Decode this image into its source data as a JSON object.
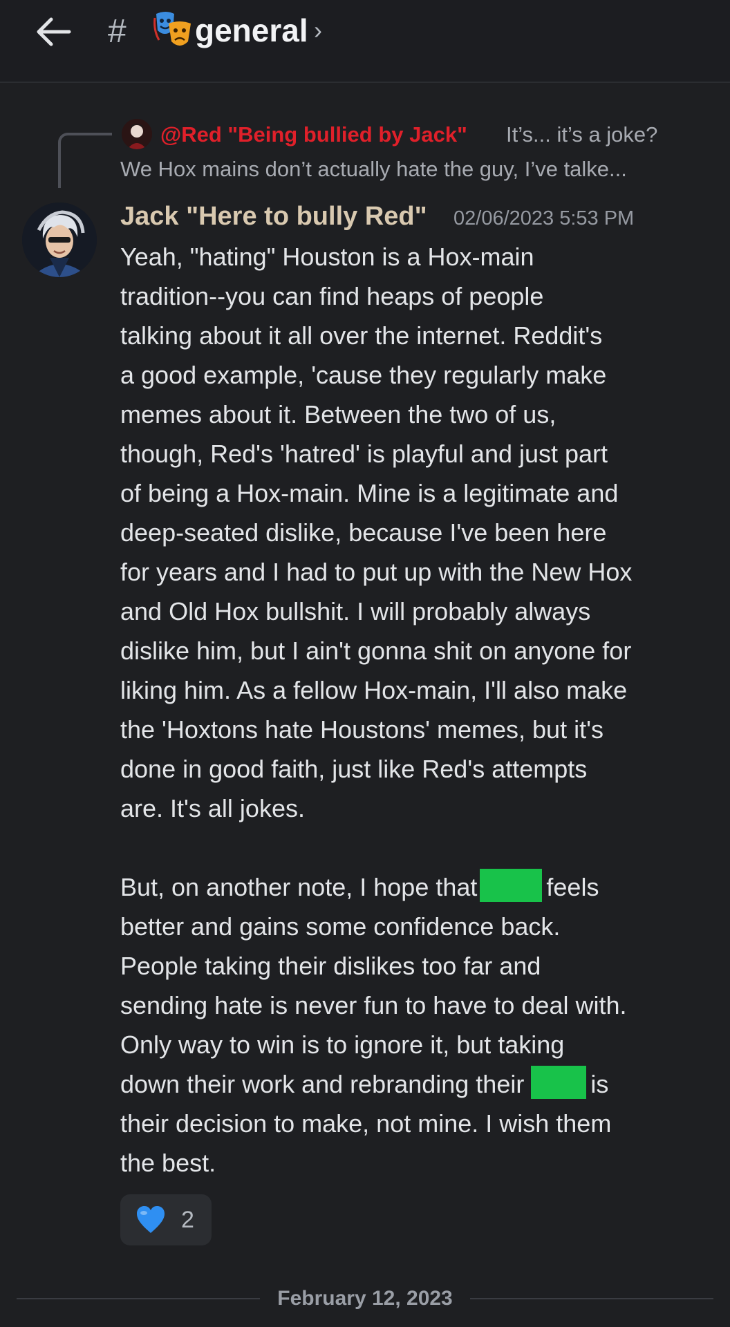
{
  "header": {
    "channel_name": "general",
    "icons": [
      "back-arrow-icon",
      "hash-icon",
      "theater-masks-emoji",
      "chevron-right-icon"
    ]
  },
  "reply": {
    "author": "@Red \"Being bullied by Jack\"",
    "text_line1": "It’s... it’s a joke?",
    "text_line2": "We Hox mains don’t actually hate the guy, I’ve talke...",
    "author_color": "#e0202a"
  },
  "message": {
    "author": "Jack \"Here to bully Red\"",
    "timestamp": "02/06/2023 5:53 PM",
    "lines": [
      "Yeah, \"hating\" Houston is a Hox-main",
      "tradition--you can find heaps of people",
      "talking about it all over the internet. Reddit's",
      "a good example, 'cause they regularly make",
      "memes about it. Between the two of us,",
      "though, Red's 'hatred' is playful and just part",
      "of being a Hox-main. Mine is a legitimate and",
      "deep-seated dislike, because I've been here",
      "for years and I had to put up with the New Hox",
      "and Old Hox bullshit. I will probably always",
      "dislike him, but I ain't gonna shit on anyone for",
      "liking him. As a fellow Hox-main, I'll also make",
      "the 'Hoxtons hate Houstons' memes, but it's",
      "done in good faith, just like Red's attempts",
      "are. It's all jokes."
    ],
    "para2": {
      "line1_before": "But, on another note, I hope that",
      "line1_after": "feels",
      "line2": "better and gains some confidence back.",
      "line3": "People taking their dislikes too far and",
      "line4": "sending hate is never fun to have to deal with.",
      "line5": "Only way to win is to ignore it, but taking",
      "line6_before": "down their work and rebranding their",
      "line6_after": "is",
      "line7": "their decision to make, not mine. I wish them",
      "line8": "the best."
    },
    "spoiler_color": "#18c24a"
  },
  "reaction": {
    "emoji": "blue-heart-icon",
    "count": "2"
  },
  "date_divider": "February 12, 2023"
}
